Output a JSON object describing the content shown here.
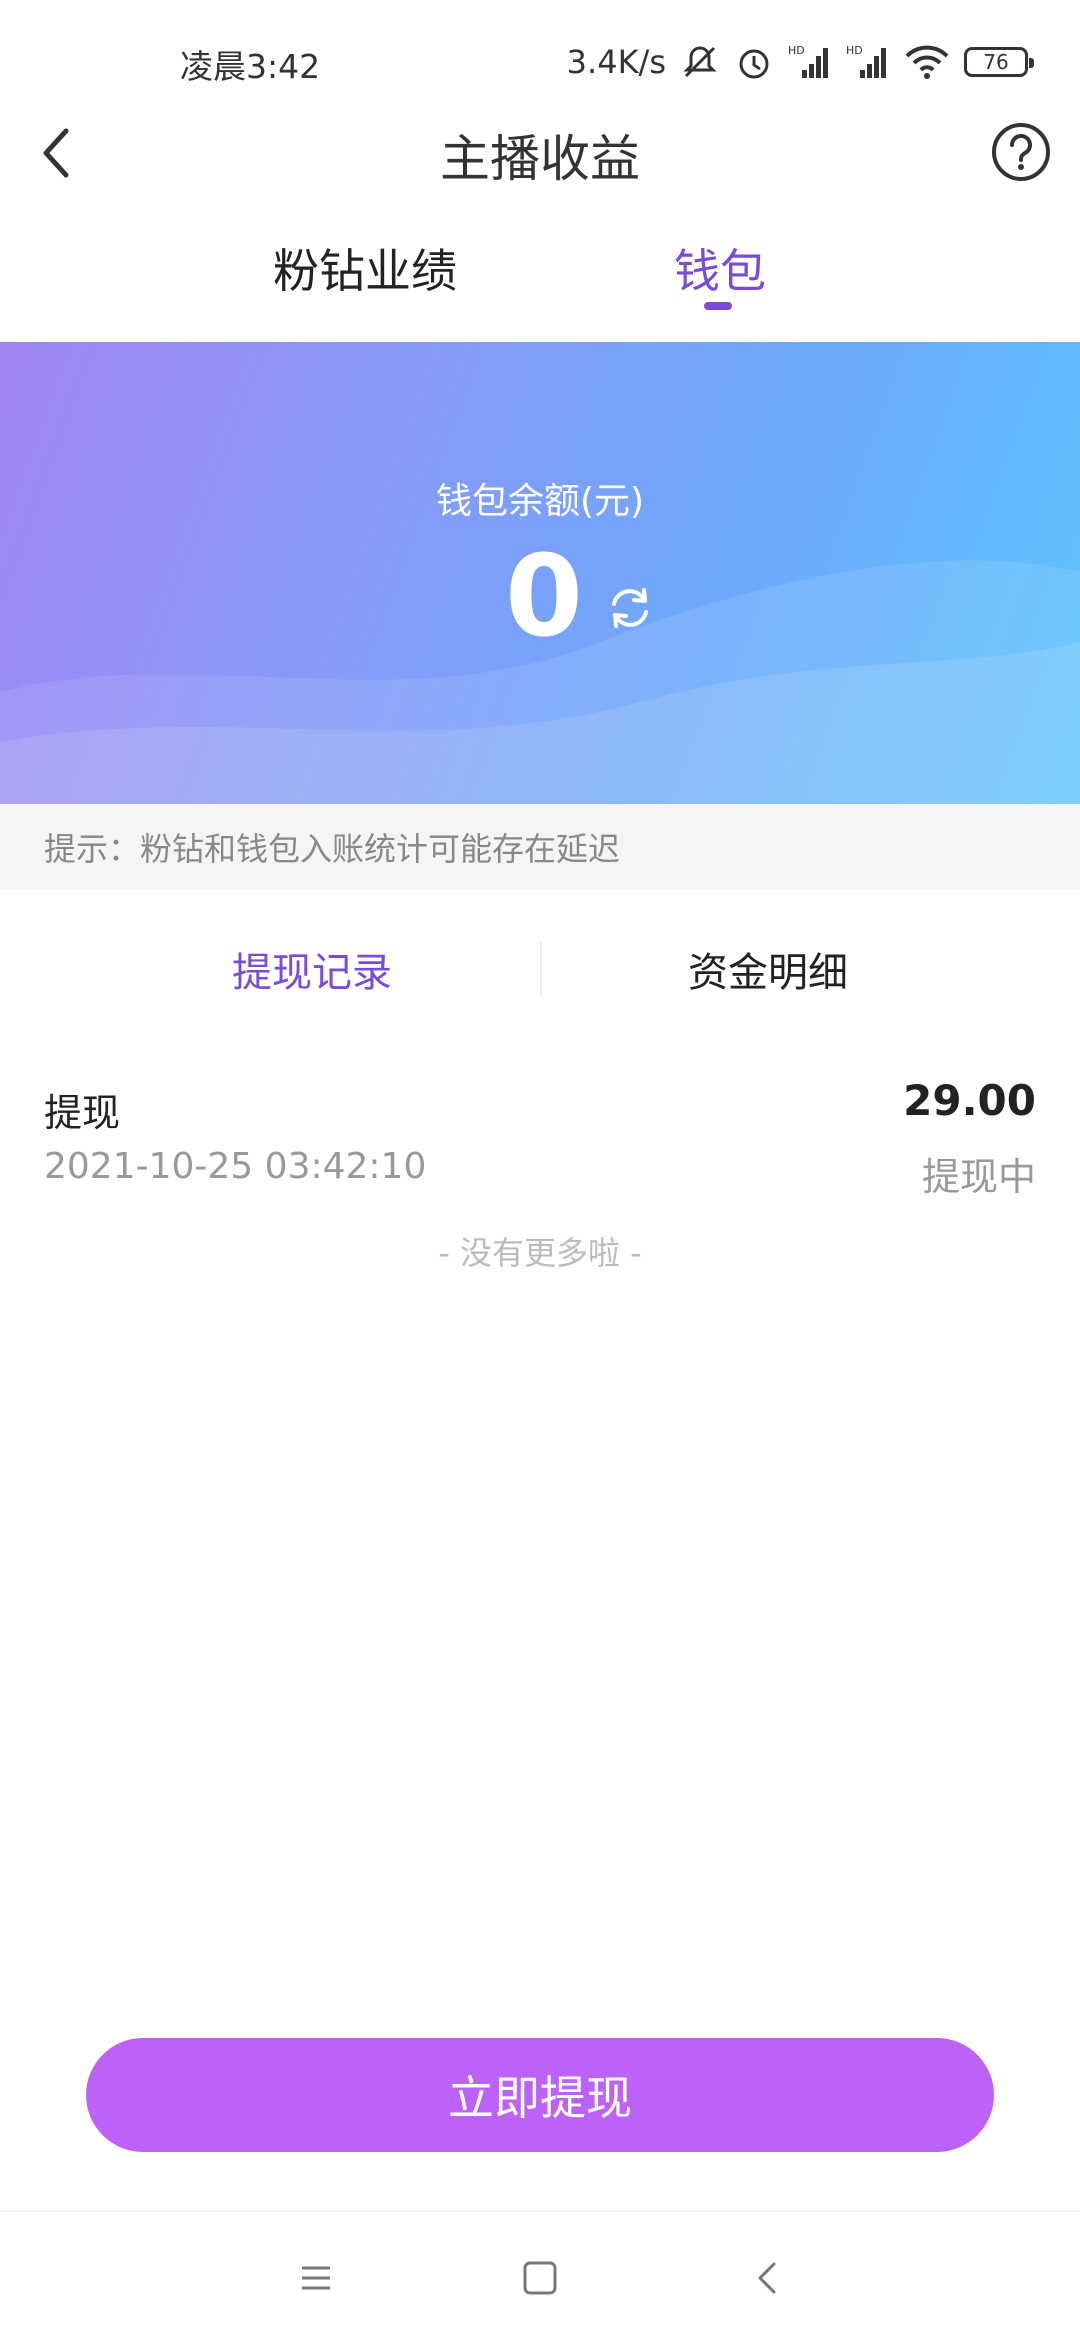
{
  "status_bar": {
    "time": "凌晨3:42",
    "net_speed": "3.4K/s",
    "battery": "76",
    "icons": [
      "mute-icon",
      "alarm-icon",
      "signal-icon",
      "signal-icon",
      "wifi-icon",
      "battery-icon"
    ]
  },
  "header": {
    "title": "主播收益",
    "back_icon": "chevron-left-icon",
    "help_icon": "help-icon"
  },
  "tabs": [
    {
      "label": "粉钻业绩",
      "active": false
    },
    {
      "label": "钱包",
      "active": true
    }
  ],
  "wallet": {
    "balance_label": "钱包余额(元)",
    "balance": "0",
    "refresh_icon": "refresh-icon"
  },
  "tip": "提示：粉钻和钱包入账统计可能存在延迟",
  "subtabs": [
    {
      "label": "提现记录",
      "active": true
    },
    {
      "label": "资金明细",
      "active": false
    }
  ],
  "records": [
    {
      "title": "提现",
      "time": "2021-10-25 03:42:10",
      "amount": "29.00",
      "status": "提现中"
    }
  ],
  "no_more": "- 没有更多啦 -",
  "withdraw_button": "立即提现",
  "colors": {
    "accent": "#7a4bd6",
    "button": "#bd62f8",
    "banner_start": "#a184f6",
    "banner_end": "#5cc4fd"
  },
  "nav": {
    "icons": [
      "menu-icon",
      "home-icon",
      "back-icon"
    ]
  }
}
